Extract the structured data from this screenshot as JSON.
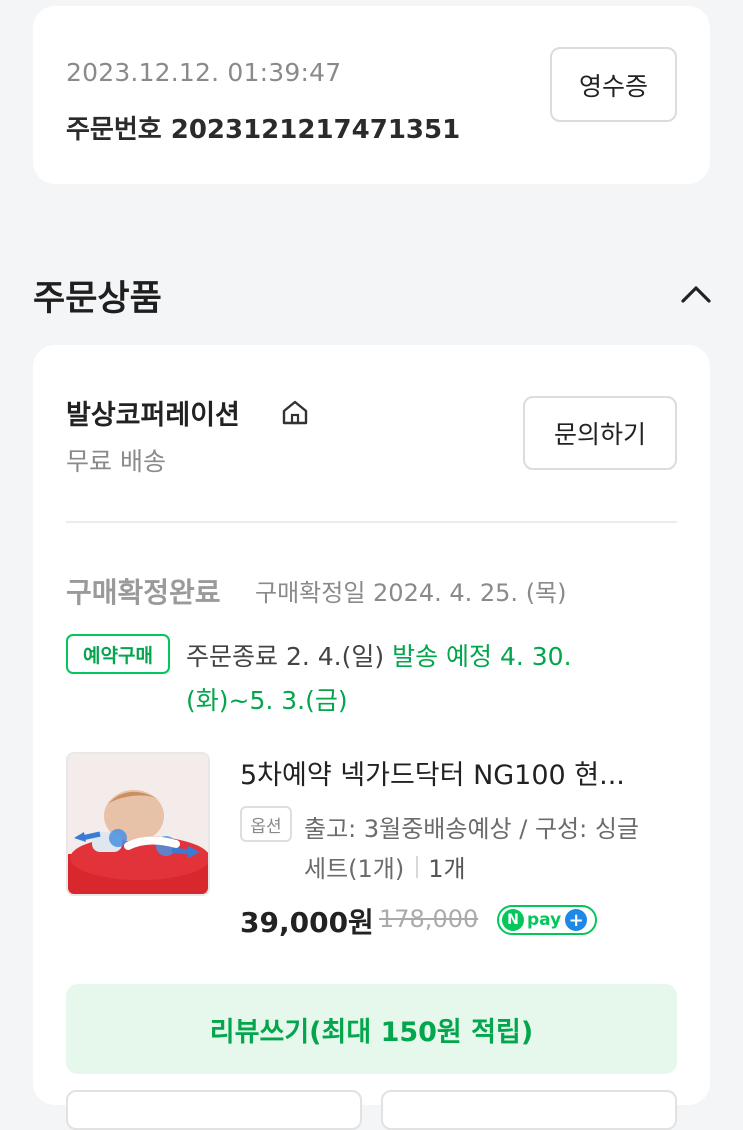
{
  "order": {
    "datetime": "2023.12.12. 01:39:47",
    "number": "주문번호 2023121217471351",
    "receipt_label": "영수증"
  },
  "section": {
    "title": "주문상품"
  },
  "seller": {
    "name": "발상코퍼레이션",
    "shipping": "무료 배송",
    "inquiry_label": "문의하기"
  },
  "status": {
    "label": "구매확정완료",
    "confirm_date": "구매확정일 2024. 4. 25. (목)"
  },
  "reservation": {
    "badge": "예약구매",
    "order_end": "주문종료 2. 4.(일) ",
    "ship_schedule_line1": "발송 예정 4. 30.",
    "ship_schedule_line2": "(화)~5. 3.(금)"
  },
  "product": {
    "name": "5차예약 넥가드닥터 NG100 현...",
    "option_badge": "옵션",
    "option_line1": "출고: 3월중배송예상 / 구성: 싱글",
    "option_line2": "세트(1개)",
    "quantity": "1개",
    "price": "39,000원",
    "original_price": "178,000",
    "npay_label": "pay"
  },
  "review": {
    "label": "리뷰쓰기(최대 150원 적립)"
  },
  "colors": {
    "accent_green": "#03c75a",
    "text_green": "#03a64c",
    "review_bg": "#e6f7ec",
    "npay_plus": "#1e88e5"
  }
}
